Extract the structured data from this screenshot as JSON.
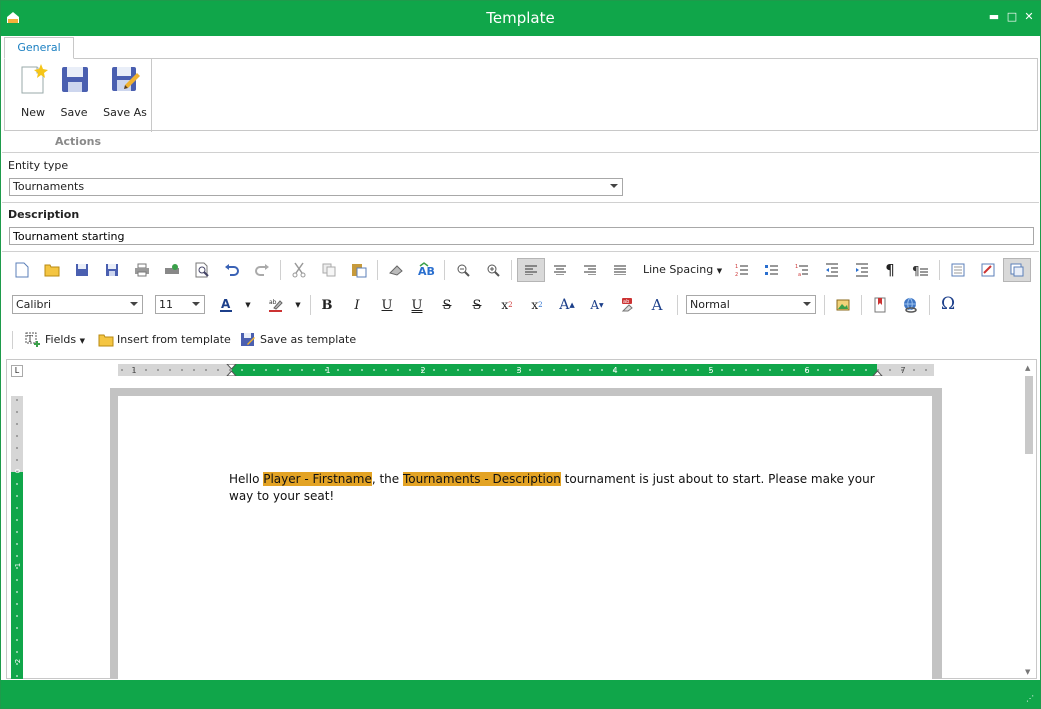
{
  "window": {
    "title": "Template"
  },
  "ribbon": {
    "tabs": [
      {
        "label": "General"
      }
    ],
    "buttons": {
      "new": "New",
      "save": "Save",
      "save_as": "Save As"
    },
    "group_label": "Actions"
  },
  "form": {
    "entity_type_label": "Entity type",
    "entity_type_value": "Tournaments",
    "description_label": "Description",
    "description_value": "Tournament starting"
  },
  "editor_toolbar": {
    "line_spacing": "Line Spacing",
    "font_name": "Calibri",
    "font_size": "11",
    "style_name": "Normal",
    "fields": "Fields",
    "insert_from_template": "Insert from template",
    "save_as_template": "Save as template"
  },
  "ruler": {
    "h_ticks": [
      "1",
      "1",
      "2",
      "3",
      "4",
      "5",
      "6",
      "7"
    ],
    "v_ticks": [
      "0",
      "1",
      "2"
    ]
  },
  "document": {
    "text_1": "Hello ",
    "field_1": "Player - Firstname",
    "text_2": ", the ",
    "field_2": "Tournaments - Description",
    "text_3": " tournament is just about to start. Please make your way to your seat!"
  },
  "colors": {
    "accent": "#10a64a",
    "field_highlight": "#e3a324"
  }
}
